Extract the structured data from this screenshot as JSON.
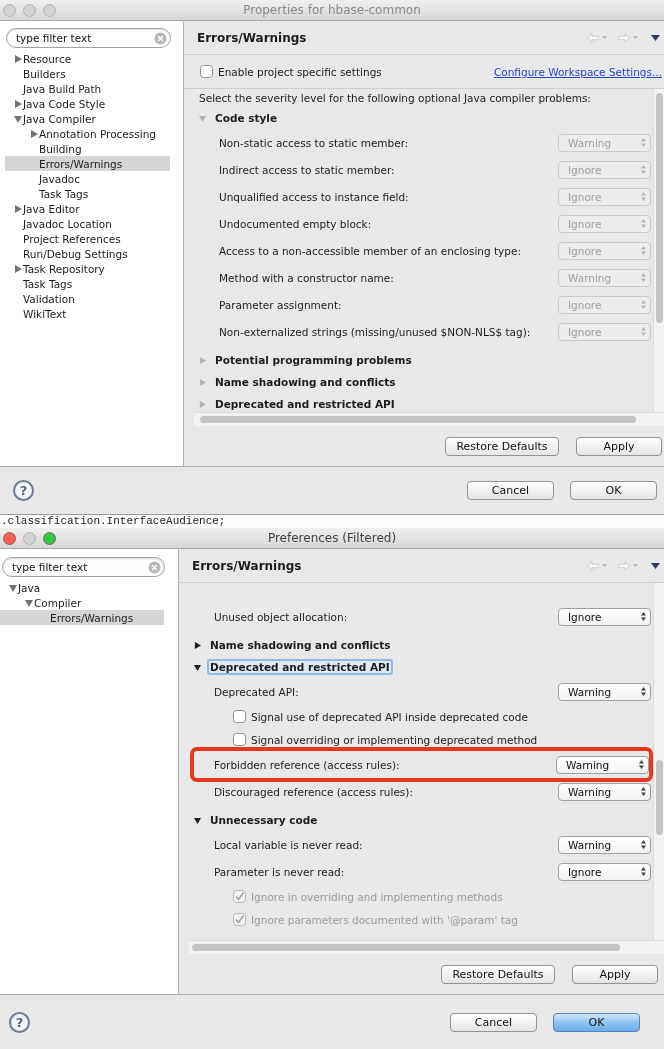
{
  "windows": [
    {
      "kind": "dialog",
      "title": "Properties for hbase-common",
      "active": false,
      "window_buttons": [
        {
          "kind": "close",
          "lit": false
        },
        {
          "kind": "minimize",
          "lit": false
        },
        {
          "kind": "zoom",
          "lit": false
        }
      ],
      "filter": {
        "value": "type filter text"
      },
      "tree": [
        {
          "label": "Resource",
          "expandable": true,
          "expanded": false,
          "selected": false
        },
        {
          "label": "Builders",
          "expandable": false,
          "selected": false
        },
        {
          "label": "Java Build Path",
          "expandable": false,
          "selected": false
        },
        {
          "label": "Java Code Style",
          "expandable": true,
          "expanded": false,
          "selected": false
        },
        {
          "label": "Java Compiler",
          "expandable": true,
          "expanded": true,
          "selected": false,
          "children": [
            {
              "label": "Annotation Processing",
              "expandable": true,
              "expanded": false,
              "selected": false
            },
            {
              "label": "Building",
              "expandable": false,
              "selected": false
            },
            {
              "label": "Errors/Warnings",
              "expandable": false,
              "selected": true
            },
            {
              "label": "Javadoc",
              "expandable": false,
              "selected": false
            },
            {
              "label": "Task Tags",
              "expandable": false,
              "selected": false
            }
          ]
        },
        {
          "label": "Java Editor",
          "expandable": true,
          "expanded": false,
          "selected": false
        },
        {
          "label": "Javadoc Location",
          "expandable": false,
          "selected": false
        },
        {
          "label": "Project References",
          "expandable": false,
          "selected": false
        },
        {
          "label": "Run/Debug Settings",
          "expandable": false,
          "selected": false
        },
        {
          "label": "Task Repository",
          "expandable": true,
          "expanded": false,
          "selected": false
        },
        {
          "label": "Task Tags",
          "expandable": false,
          "selected": false
        },
        {
          "label": "Validation",
          "expandable": false,
          "selected": false
        },
        {
          "label": "WikiText",
          "expandable": false,
          "selected": false
        }
      ],
      "page_title": "Errors/Warnings",
      "project_settings": {
        "label": "Enable project specific settings",
        "checked": false,
        "link": "Configure Workspace Settings..."
      },
      "intro": "Select the severity level for the following optional Java compiler problems:",
      "options": [
        {
          "kind": "section",
          "label": "Code style",
          "expanded": true,
          "focused": false
        },
        {
          "kind": "combo",
          "label": "Non-static access to static member:",
          "value": "Warning",
          "disabled": true,
          "highlighted": false
        },
        {
          "kind": "combo",
          "label": "Indirect access to static member:",
          "value": "Ignore",
          "disabled": true,
          "highlighted": false
        },
        {
          "kind": "combo",
          "label": "Unqualified access to instance field:",
          "value": "Ignore",
          "disabled": true,
          "highlighted": false
        },
        {
          "kind": "combo",
          "label": "Undocumented empty block:",
          "value": "Ignore",
          "disabled": true,
          "highlighted": false
        },
        {
          "kind": "combo",
          "label": "Access to a non-accessible member of an enclosing type:",
          "value": "Ignore",
          "disabled": true,
          "highlighted": false
        },
        {
          "kind": "combo",
          "label": "Method with a constructor name:",
          "value": "Warning",
          "disabled": true,
          "highlighted": false
        },
        {
          "kind": "combo",
          "label": "Parameter assignment:",
          "value": "Ignore",
          "disabled": true,
          "highlighted": false
        },
        {
          "kind": "combo",
          "label": "Non-externalized strings (missing/unused $NON-NLS$ tag):",
          "value": "Ignore",
          "disabled": true,
          "highlighted": false
        },
        {
          "kind": "section",
          "label": "Potential programming problems",
          "expanded": false,
          "focused": false
        },
        {
          "kind": "section",
          "label": "Name shadowing and conflicts",
          "expanded": false,
          "focused": false
        },
        {
          "kind": "section",
          "label": "Deprecated and restricted API",
          "expanded": false,
          "focused": false
        }
      ],
      "page_buttons": [
        "Restore Defaults",
        "Apply"
      ],
      "help_button": "?",
      "dialog_buttons": [
        {
          "label": "Cancel",
          "default": false
        },
        {
          "label": "OK",
          "default": false
        }
      ]
    },
    {
      "kind": "editor",
      "code_line": ".classification.InterfaceAudience;"
    },
    {
      "kind": "dialog",
      "title": "Preferences (Filtered)",
      "active": true,
      "window_buttons": [
        {
          "kind": "close",
          "lit": true
        },
        {
          "kind": "minimize",
          "lit": false
        },
        {
          "kind": "zoom",
          "lit": true
        }
      ],
      "filter": {
        "value": "type filter text"
      },
      "tree": [
        {
          "label": "Java",
          "expandable": true,
          "expanded": true,
          "selected": false,
          "children": [
            {
              "label": "Compiler",
              "expandable": true,
              "expanded": true,
              "selected": false,
              "children": [
                {
                  "label": "Errors/Warnings",
                  "expandable": false,
                  "selected": true
                }
              ]
            }
          ]
        }
      ],
      "page_title": "Errors/Warnings",
      "options": [
        {
          "kind": "combo",
          "label": "Unused object allocation:",
          "value": "Ignore",
          "disabled": false,
          "highlighted": false
        },
        {
          "kind": "section",
          "label": "Name shadowing and conflicts",
          "expanded": false,
          "focused": false
        },
        {
          "kind": "section",
          "label": "Deprecated and restricted API",
          "expanded": true,
          "focused": true
        },
        {
          "kind": "combo",
          "label": "Deprecated API:",
          "value": "Warning",
          "disabled": false,
          "highlighted": false
        },
        {
          "kind": "checkbox",
          "label": "Signal use of deprecated API inside deprecated code",
          "checked": false,
          "disabled": false
        },
        {
          "kind": "checkbox",
          "label": "Signal overriding or implementing deprecated method",
          "checked": false,
          "disabled": false
        },
        {
          "kind": "combo",
          "label": "Forbidden reference (access rules):",
          "value": "Warning",
          "disabled": false,
          "highlighted": true
        },
        {
          "kind": "combo",
          "label": "Discouraged reference (access rules):",
          "value": "Warning",
          "disabled": false,
          "highlighted": false
        },
        {
          "kind": "section",
          "label": "Unnecessary code",
          "expanded": true,
          "focused": false
        },
        {
          "kind": "combo",
          "label": "Local variable is never read:",
          "value": "Warning",
          "disabled": false,
          "highlighted": false
        },
        {
          "kind": "combo",
          "label": "Parameter is never read:",
          "value": "Ignore",
          "disabled": false,
          "highlighted": false
        },
        {
          "kind": "checkbox",
          "label": "Ignore in overriding and implementing methods",
          "checked": true,
          "disabled": true
        },
        {
          "kind": "checkbox",
          "label": "Ignore parameters documented with '@param' tag",
          "checked": true,
          "disabled": true
        }
      ],
      "page_buttons": [
        "Restore Defaults",
        "Apply"
      ],
      "help_button": "?",
      "dialog_buttons": [
        {
          "label": "Cancel",
          "default": false
        },
        {
          "label": "OK",
          "default": true
        }
      ]
    }
  ]
}
